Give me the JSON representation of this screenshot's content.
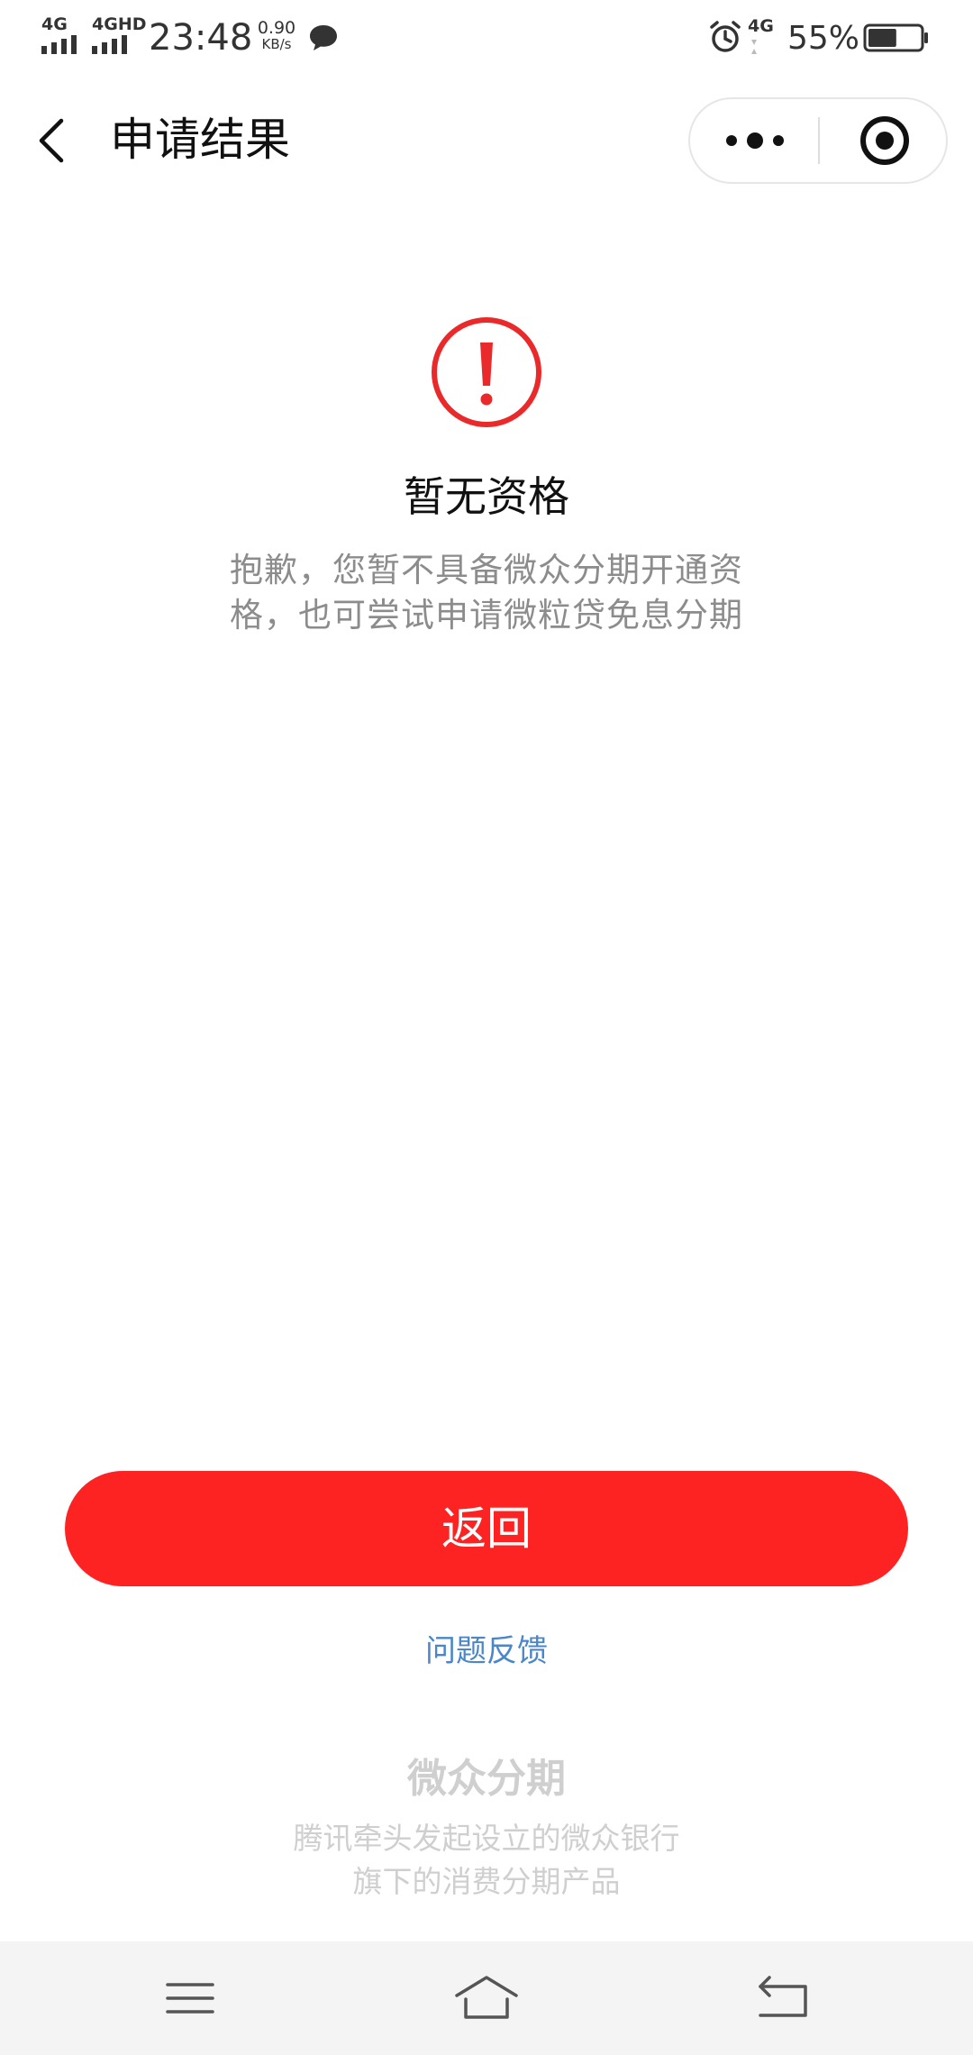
{
  "status_bar": {
    "signal_1_label": "4G",
    "signal_2_label": "4GHD",
    "time": "23:48",
    "net_speed_value": "0.90",
    "net_speed_unit": "KB/s",
    "signal_3_label": "4G",
    "battery_percent": "55%",
    "battery_level": 0.55
  },
  "nav": {
    "title": "申请结果"
  },
  "result": {
    "status": "error",
    "title": "暂无资格",
    "description": "抱歉，您暂不具备微众分期开通资格，也可尝试申请微粒贷免息分期"
  },
  "actions": {
    "return_label": "返回",
    "feedback_label": "问题反馈"
  },
  "brand": {
    "name": "微众分期",
    "description_line1": "腾讯牵头发起设立的微众银行",
    "description_line2": "旗下的消费分期产品"
  },
  "colors": {
    "primary_red": "#fe2323",
    "link_blue": "#4a86c8",
    "muted_text": "#8c8c8c",
    "brand_text": "#cfcfcf"
  },
  "icons": {
    "back": "chevron-left-icon",
    "more": "more-dots-icon",
    "close": "target-icon",
    "result": "exclamation-circle-icon",
    "sys_menu": "menu-lines-icon",
    "sys_home": "home-icon",
    "sys_back": "back-return-icon"
  }
}
